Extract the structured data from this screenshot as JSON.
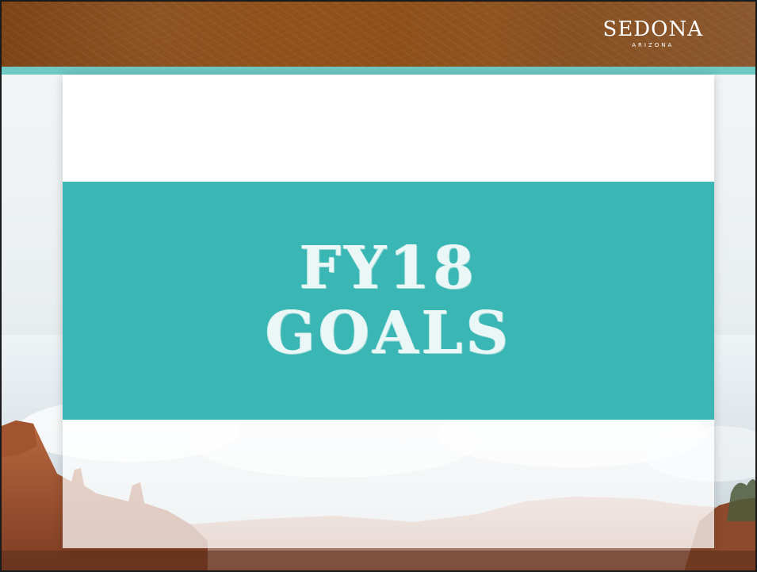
{
  "logo": {
    "name": "SEDONA",
    "subtitle": "ARIZONA"
  },
  "slide": {
    "title_line1": "FY18",
    "title_line2": "GOALS"
  },
  "colors": {
    "banner_brown": "#8c4a12",
    "teal_strip": "#6fcac4",
    "title_block": "#3ab7b4",
    "title_text": "#eaf7f6"
  }
}
